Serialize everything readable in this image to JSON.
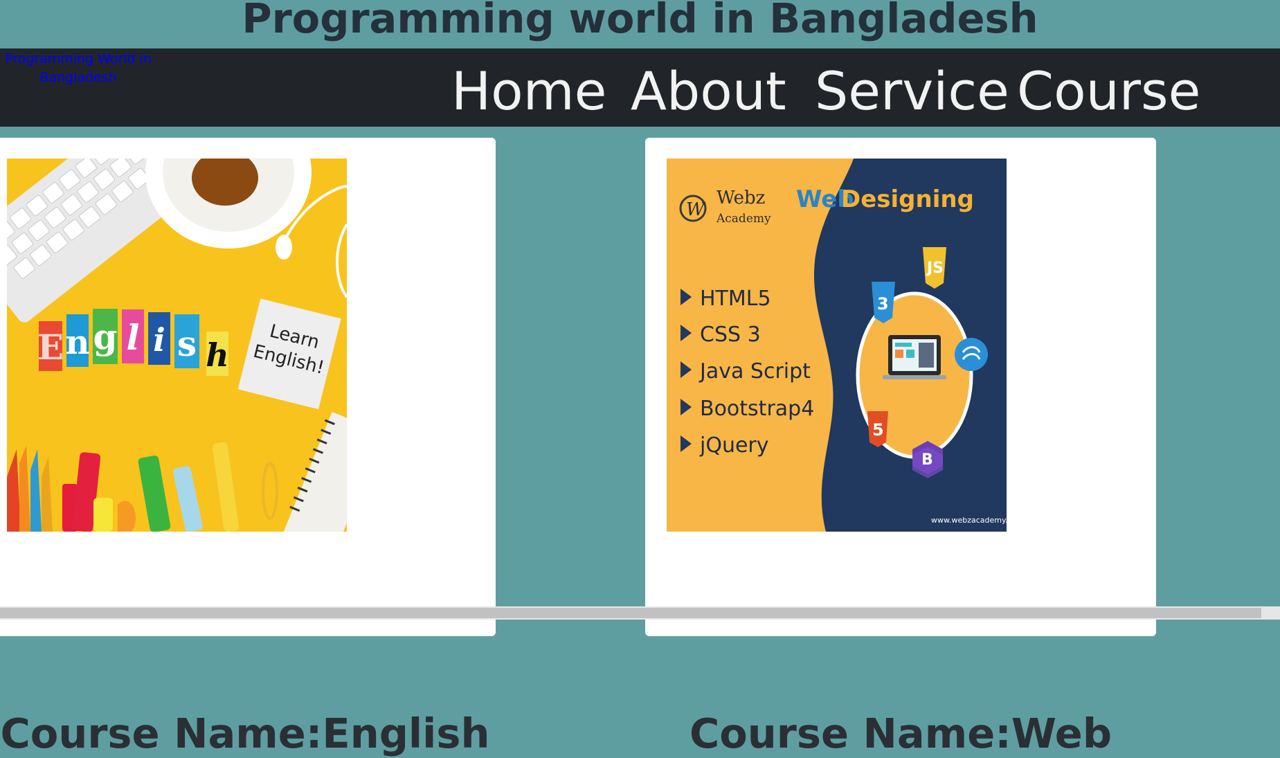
{
  "header": {
    "title": "Programming world in Bangladesh"
  },
  "navbar": {
    "brand": "Programming World in Bangladesh",
    "links": [
      "Home",
      "About",
      "Service",
      "Course"
    ]
  },
  "courses": [
    {
      "name": "Course Name:English",
      "image_words": {
        "letters": [
          "E",
          "n",
          "g",
          "l",
          "i",
          "s",
          "h"
        ],
        "note": "Learn English!"
      }
    },
    {
      "name": "Course Name:Web",
      "image_words": {
        "logo_line1": "Webz",
        "logo_line2": "Academy",
        "headline_a": "Web",
        "headline_b": "Designing",
        "topics": [
          "HTML5",
          "CSS 3",
          "Java Script",
          "Bootstrap4",
          "jQuery"
        ],
        "url": "www.webzacademy.com"
      }
    }
  ],
  "colors": {
    "background": "#5f9ea0",
    "navbar": "#212529",
    "brand": "#0000ff",
    "card": "#ffffff"
  }
}
